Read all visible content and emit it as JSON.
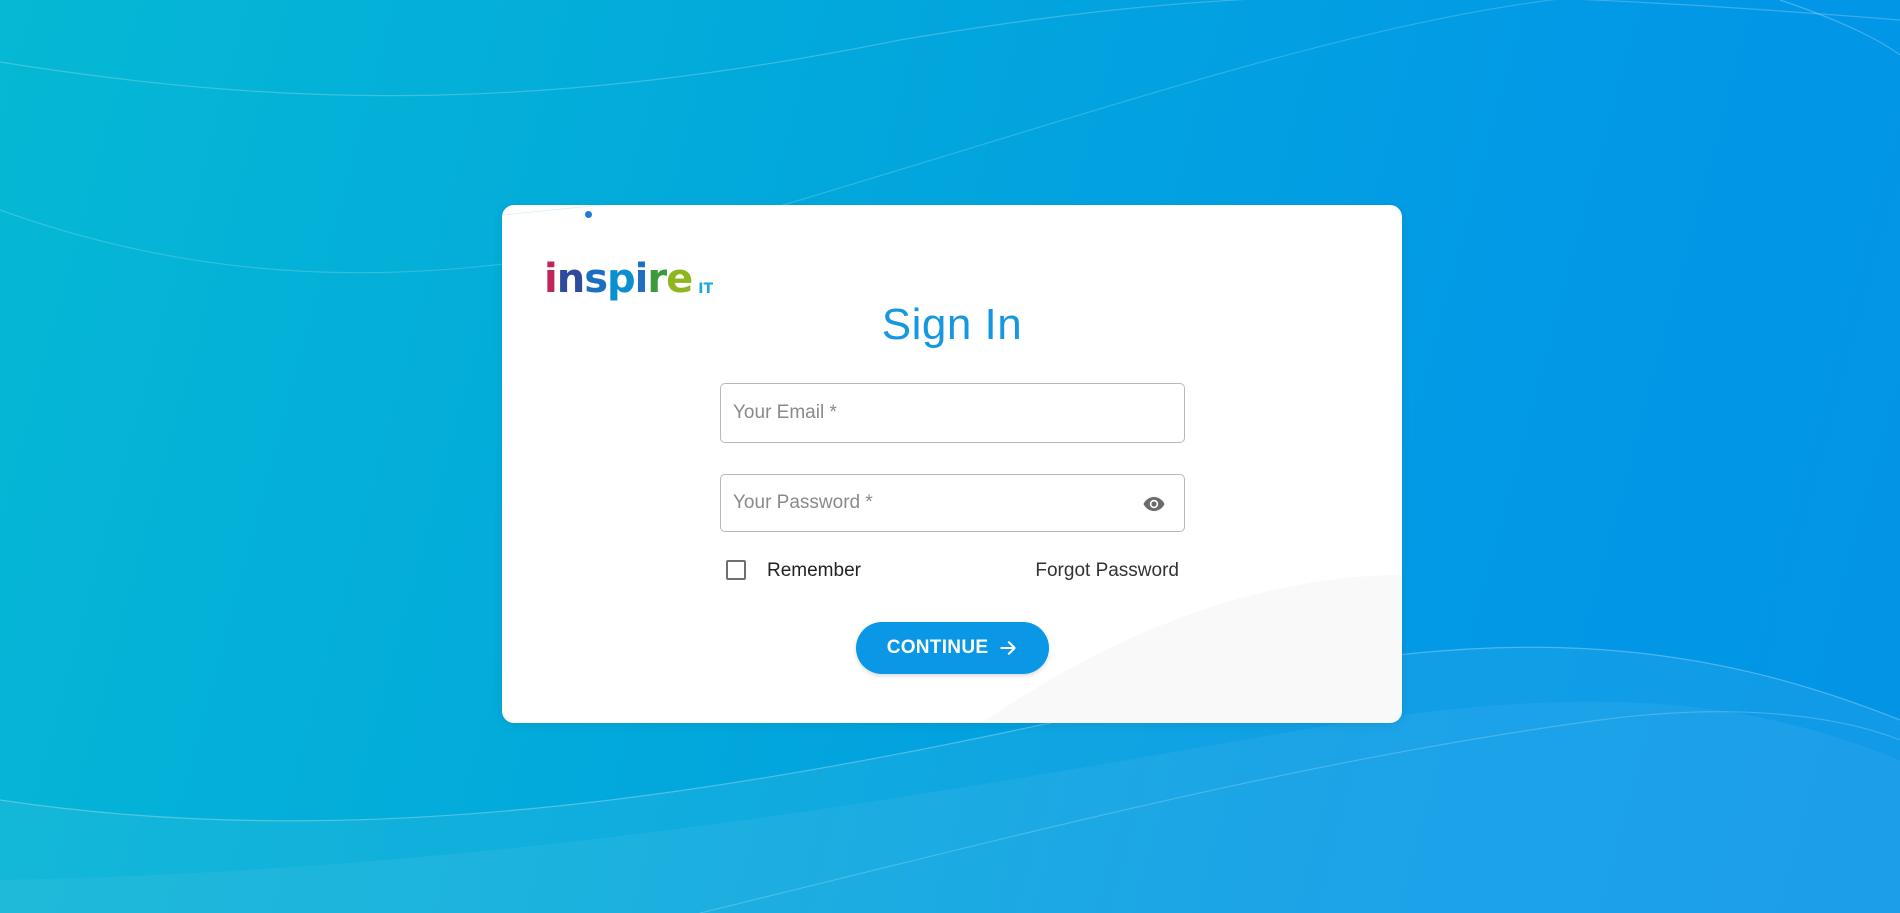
{
  "brand": {
    "logo_word": "inspire",
    "logo_suffix": "IT"
  },
  "signin": {
    "title": "Sign In",
    "email_placeholder": "Your Email *",
    "email_value": "",
    "password_placeholder": "Your Password *",
    "password_value": "",
    "remember_label": "Remember",
    "remember_checked": false,
    "forgot_label": "Forgot Password",
    "continue_label": "CONTINUE"
  },
  "icons": {
    "password_toggle": "eye-icon",
    "continue_arrow": "arrow-right-icon"
  },
  "colors": {
    "accent": "#0a97e6",
    "title": "#1597e1",
    "background_start": "#06b8d4",
    "background_end": "#0393e6"
  }
}
